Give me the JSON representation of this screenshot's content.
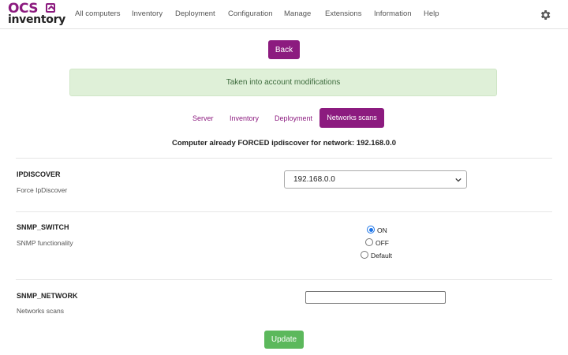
{
  "brand": {
    "logo_top": "OCS",
    "logo_bottom": "inventory"
  },
  "nav": {
    "items": [
      "All computers",
      "Inventory",
      "Deployment",
      "Configuration",
      "Manage",
      "Extensions",
      "Information",
      "Help"
    ],
    "settings_icon": "gear-icon"
  },
  "back_label": "Back",
  "alert_message": "Taken into account modifications",
  "tabs": [
    "Server",
    "Inventory",
    "Deployment",
    "Networks scans"
  ],
  "active_tab": "Networks scans",
  "info_line": "Computer already FORCED ipdiscover for network: 192.168.0.0",
  "settings": {
    "ipdiscover": {
      "name": "IPDISCOVER",
      "description": "Force IpDiscover",
      "selected": "192.168.0.0"
    },
    "snmp_switch": {
      "name": "SNMP_SWITCH",
      "description": "SNMP functionality",
      "options": [
        "ON",
        "OFF",
        "Default"
      ],
      "selected": "ON"
    },
    "snmp_network": {
      "name": "SNMP_NETWORK",
      "description": "Networks scans",
      "value": ""
    }
  },
  "update_label": "Update",
  "colors": {
    "brand": "#8c1b7f",
    "success_button": "#5cb85c",
    "alert_bg": "#dff0d8",
    "radio_checked": "#1a73e8"
  }
}
